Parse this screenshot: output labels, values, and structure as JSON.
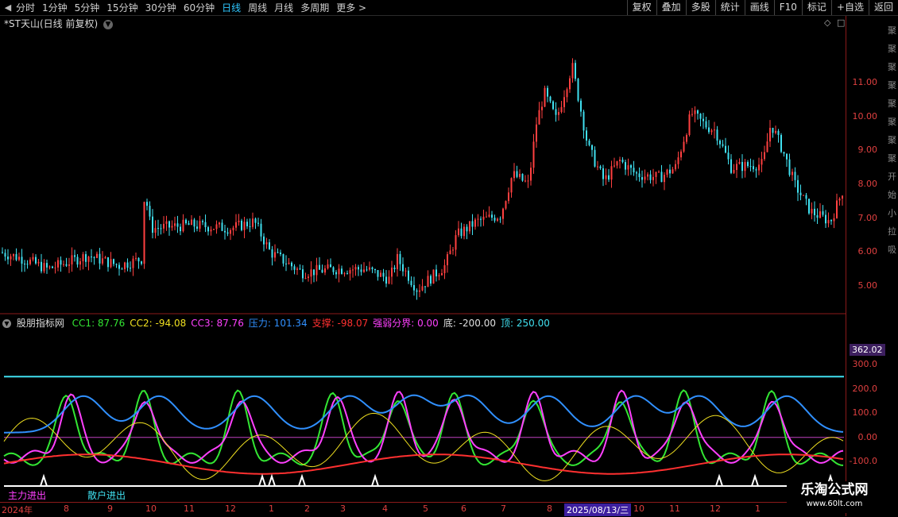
{
  "toolbar": {
    "back_icon": "chevron-left-icon",
    "periods": [
      "分时",
      "1分钟",
      "5分钟",
      "15分钟",
      "30分钟",
      "60分钟",
      "日线",
      "周线",
      "月线",
      "多周期",
      "更多 >"
    ],
    "active_period": "日线",
    "right_buttons": [
      "复权",
      "叠加",
      "多股",
      "统计",
      "画线",
      "F10",
      "标记",
      "+自选",
      "返回"
    ]
  },
  "main_chart": {
    "title": "*ST天山(日线 前复权)",
    "y_ticks": [
      "11.00",
      "10.00",
      "9.00",
      "8.00",
      "7.00",
      "6.00",
      "5.00"
    ],
    "y_range": [
      4.3,
      12.5
    ],
    "side_chars": [
      "聚",
      "聚",
      "聚",
      "聚",
      "聚",
      "聚",
      "聚",
      "聚",
      "开",
      "始",
      "小",
      "拉",
      "吸"
    ],
    "colors": {
      "up": "#ff4040",
      "down": "#40e0f0"
    }
  },
  "indicator": {
    "name": "股朋指标网",
    "values": [
      {
        "label": "CC1: 87.76",
        "color": "#33e633"
      },
      {
        "label": "CC2: -94.08",
        "color": "#f0e020"
      },
      {
        "label": "CC3: 87.76",
        "color": "#ff40ff"
      },
      {
        "label": "压力: 101.34",
        "color": "#3090ff"
      },
      {
        "label": "支撑: -98.07",
        "color": "#ff3030"
      },
      {
        "label": "强弱分界: 0.00",
        "color": "#ff40ff"
      },
      {
        "label": "底: -200.00",
        "color": "#e0e0e0"
      },
      {
        "label": "顶: 250.00",
        "color": "#40e0f0"
      }
    ],
    "y_ticks": [
      "300.0",
      "200.0",
      "100.0",
      "0.00",
      "-100.0"
    ],
    "y_range": [
      -200,
      362.02
    ],
    "max_label": "362.02",
    "bottom_labels": [
      "主力进出",
      "散户进出"
    ]
  },
  "dates": {
    "labels": [
      "2024年",
      "8",
      "9",
      "10",
      "11",
      "12",
      "1",
      "2",
      "3",
      "4",
      "5",
      "6",
      "7",
      "8",
      "2025/08/13/三",
      "10",
      "11",
      "12",
      "1"
    ],
    "selected": "2025/08/13/三"
  },
  "watermark": {
    "line1": "乐淘公式网",
    "line2": "www.60lt.com"
  }
}
